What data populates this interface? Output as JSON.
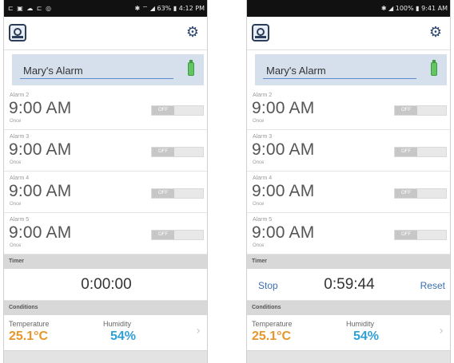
{
  "screens": [
    {
      "status": {
        "left_icons": "⊏ ▣ ☁ ⊏ ◎",
        "right_icons": "✱ ⌔ ◢ 63% ▮ 4:12 PM"
      },
      "logo_icon": "app-logo-icon",
      "settings_icon": "gear-icon",
      "alarm_name": "Mary's Alarm",
      "alarms": [
        {
          "label": "Alarm 2",
          "time": "9:00 AM",
          "repeat": "Once",
          "state": "OFF"
        },
        {
          "label": "Alarm 3",
          "time": "9:00 AM",
          "repeat": "Once",
          "state": "OFF"
        },
        {
          "label": "Alarm 4",
          "time": "9:00 AM",
          "repeat": "Once",
          "state": "OFF"
        },
        {
          "label": "Alarm 5",
          "time": "9:00 AM",
          "repeat": "Once",
          "state": "OFF"
        }
      ],
      "timer": {
        "header": "Timer",
        "value": "0:00:00",
        "stop_label": "",
        "reset_label": ""
      },
      "conditions": {
        "header": "Conditions",
        "temperature_label": "Temperature",
        "temperature_value": "25.1°C",
        "humidity_label": "Humidity",
        "humidity_value": "54%"
      }
    },
    {
      "status": {
        "left_icons": "",
        "right_icons": "✱ ◢ 100% ▮   9:41 AM"
      },
      "logo_icon": "app-logo-icon",
      "settings_icon": "gear-icon",
      "alarm_name": "Mary's Alarm",
      "alarms": [
        {
          "label": "Alarm 2",
          "time": "9:00 AM",
          "repeat": "Once",
          "state": "OFF"
        },
        {
          "label": "Alarm 3",
          "time": "9:00 AM",
          "repeat": "Once",
          "state": "OFF"
        },
        {
          "label": "Alarm 4",
          "time": "9:00 AM",
          "repeat": "Once",
          "state": "OFF"
        },
        {
          "label": "Alarm 5",
          "time": "9:00 AM",
          "repeat": "Once",
          "state": "OFF"
        }
      ],
      "timer": {
        "header": "Timer",
        "value": "0:59:44",
        "stop_label": "Stop",
        "reset_label": "Reset"
      },
      "conditions": {
        "header": "Conditions",
        "temperature_label": "Temperature",
        "temperature_value": "25.1°C",
        "humidity_label": "Humidity",
        "humidity_value": "54%"
      }
    }
  ],
  "colors": {
    "temperature": "#e8962a",
    "humidity": "#2f9fd6",
    "accent": "#3a6fb0",
    "battery": "#62c462"
  }
}
